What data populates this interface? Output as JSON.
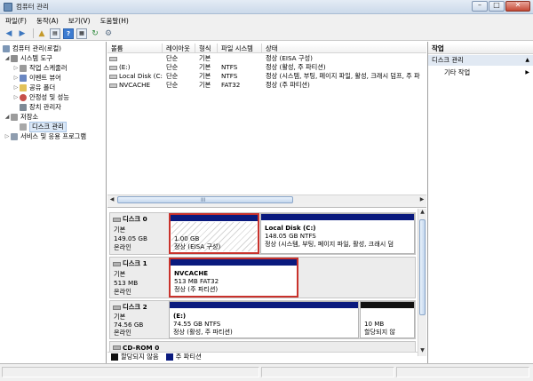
{
  "window": {
    "title": "컴퓨터 관리"
  },
  "titlebar_buttons": [
    "–",
    "□",
    "✕"
  ],
  "menu": [
    "파일(F)",
    "동작(A)",
    "보기(V)",
    "도움말(H)"
  ],
  "toolbar": [
    "back-icon",
    "forward-icon",
    "up-folder-icon",
    "show-hide-tree-icon",
    "help-icon",
    "console-view-icon",
    "export-icon",
    "properties-icon"
  ],
  "tree": [
    {
      "label": "컴퓨터 관리(로컬)",
      "twisty": ""
    },
    {
      "label": "시스템 도구",
      "twisty": "◢"
    },
    {
      "label": "작업 스케줄러",
      "twisty": "▷"
    },
    {
      "label": "이벤트 뷰어",
      "twisty": "▷"
    },
    {
      "label": "공유 폴더",
      "twisty": "▷"
    },
    {
      "label": "안정성 및 성능",
      "twisty": "▷"
    },
    {
      "label": "장치 관리자",
      "twisty": ""
    },
    {
      "label": "저장소",
      "twisty": "◢"
    },
    {
      "label": "디스크 관리",
      "twisty": ""
    },
    {
      "label": "서비스 및 응용 프로그램",
      "twisty": "▷"
    }
  ],
  "volume_list": {
    "columns": [
      "볼륨",
      "레이아웃",
      "형식",
      "파일 시스템",
      "상태"
    ],
    "rows": [
      {
        "volume": "",
        "layout": "단순",
        "type": "기본",
        "fs": "",
        "status": "정상 (EISA 구성)"
      },
      {
        "volume": "(E:)",
        "layout": "단순",
        "type": "기본",
        "fs": "NTFS",
        "status": "정상 (활성, 주 파티션)"
      },
      {
        "volume": "Local Disk (C:)",
        "layout": "단순",
        "type": "기본",
        "fs": "NTFS",
        "status": "정상 (시스템, 부팅, 페이지 파일, 활성, 크래시 덤프, 주 파"
      },
      {
        "volume": "NVCACHE",
        "layout": "단순",
        "type": "기본",
        "fs": "FAT32",
        "status": "정상 (주 파티션)"
      }
    ],
    "scroll_grip": "III"
  },
  "disks": [
    {
      "name": "디스크 0",
      "kind": "기본",
      "size": "149.05 GB",
      "state": "온라인",
      "partitions": [
        {
          "title": "",
          "line1": "1.00 GB",
          "line2": "정상 (EISA 구성)"
        },
        {
          "title": "Local Disk  (C:)",
          "line1": "148.05 GB NTFS",
          "line2": "정상 (시스템, 부팅, 페이지 파일, 활성, 크래시 덤"
        }
      ]
    },
    {
      "name": "디스크 1",
      "kind": "기본",
      "size": "513 MB",
      "state": "온라인",
      "partitions": [
        {
          "title": "NVCACHE",
          "line1": "513 MB FAT32",
          "line2": "정상 (주 파티션)"
        }
      ]
    },
    {
      "name": "디스크 2",
      "kind": "기본",
      "size": "74.56 GB",
      "state": "온라인",
      "partitions": [
        {
          "title": "(E:)",
          "line1": "74.55 GB NTFS",
          "line2": "정상 (활성, 주 파티션)"
        },
        {
          "title": "",
          "line1": "10 MB",
          "line2": "할당되지 않"
        }
      ]
    },
    {
      "name": "CD-ROM 0"
    }
  ],
  "legend": [
    {
      "label": "할당되지 않음",
      "color": "#111111"
    },
    {
      "label": "주 파티션",
      "color": "#0a1a7e"
    }
  ],
  "actions": {
    "header": "작업",
    "section": "디스크 관리",
    "item": "기타 작업"
  },
  "colors": {
    "partition_bar": "#0a1a7e",
    "unallocated_bar": "#111111",
    "selection_border": "#c9322c"
  }
}
